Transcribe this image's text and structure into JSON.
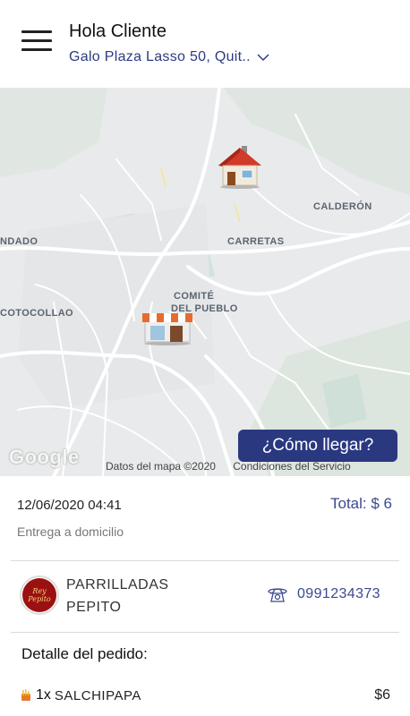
{
  "header": {
    "greeting": "Hola Cliente",
    "address": "Galo Plaza Lasso 50, Quit.."
  },
  "map": {
    "labels": {
      "calderon": "CALDERÓN",
      "carretas": "CARRETAS",
      "comite_line1": "COMITÉ",
      "comite_line2": "DEL PUEBLO",
      "ndado": "NDADO",
      "cotocollao": "COTOCOLLAO"
    },
    "google": "Google",
    "map_data": "Datos del mapa ©2020",
    "terms": "Condiciones del Servicio",
    "directions_button": "¿Cómo llegar?"
  },
  "order": {
    "date": "12/06/2020 04:41",
    "total": "Total: $ 6",
    "delivery_type": "Entrega a domicilio"
  },
  "store": {
    "logo_text": "Rey Pepito",
    "name": "PARRILLADAS PEPITO",
    "phone": "0991234373"
  },
  "detail": {
    "title": "Detalle del pedido:",
    "items": [
      {
        "qty": "1x",
        "name": "SALCHIPAPA",
        "price": "$6"
      }
    ]
  },
  "colors": {
    "accent": "#2c3a82",
    "button": "#2a3880",
    "map_bg": "#e8eaeb",
    "store_logo": "#9b1111"
  }
}
